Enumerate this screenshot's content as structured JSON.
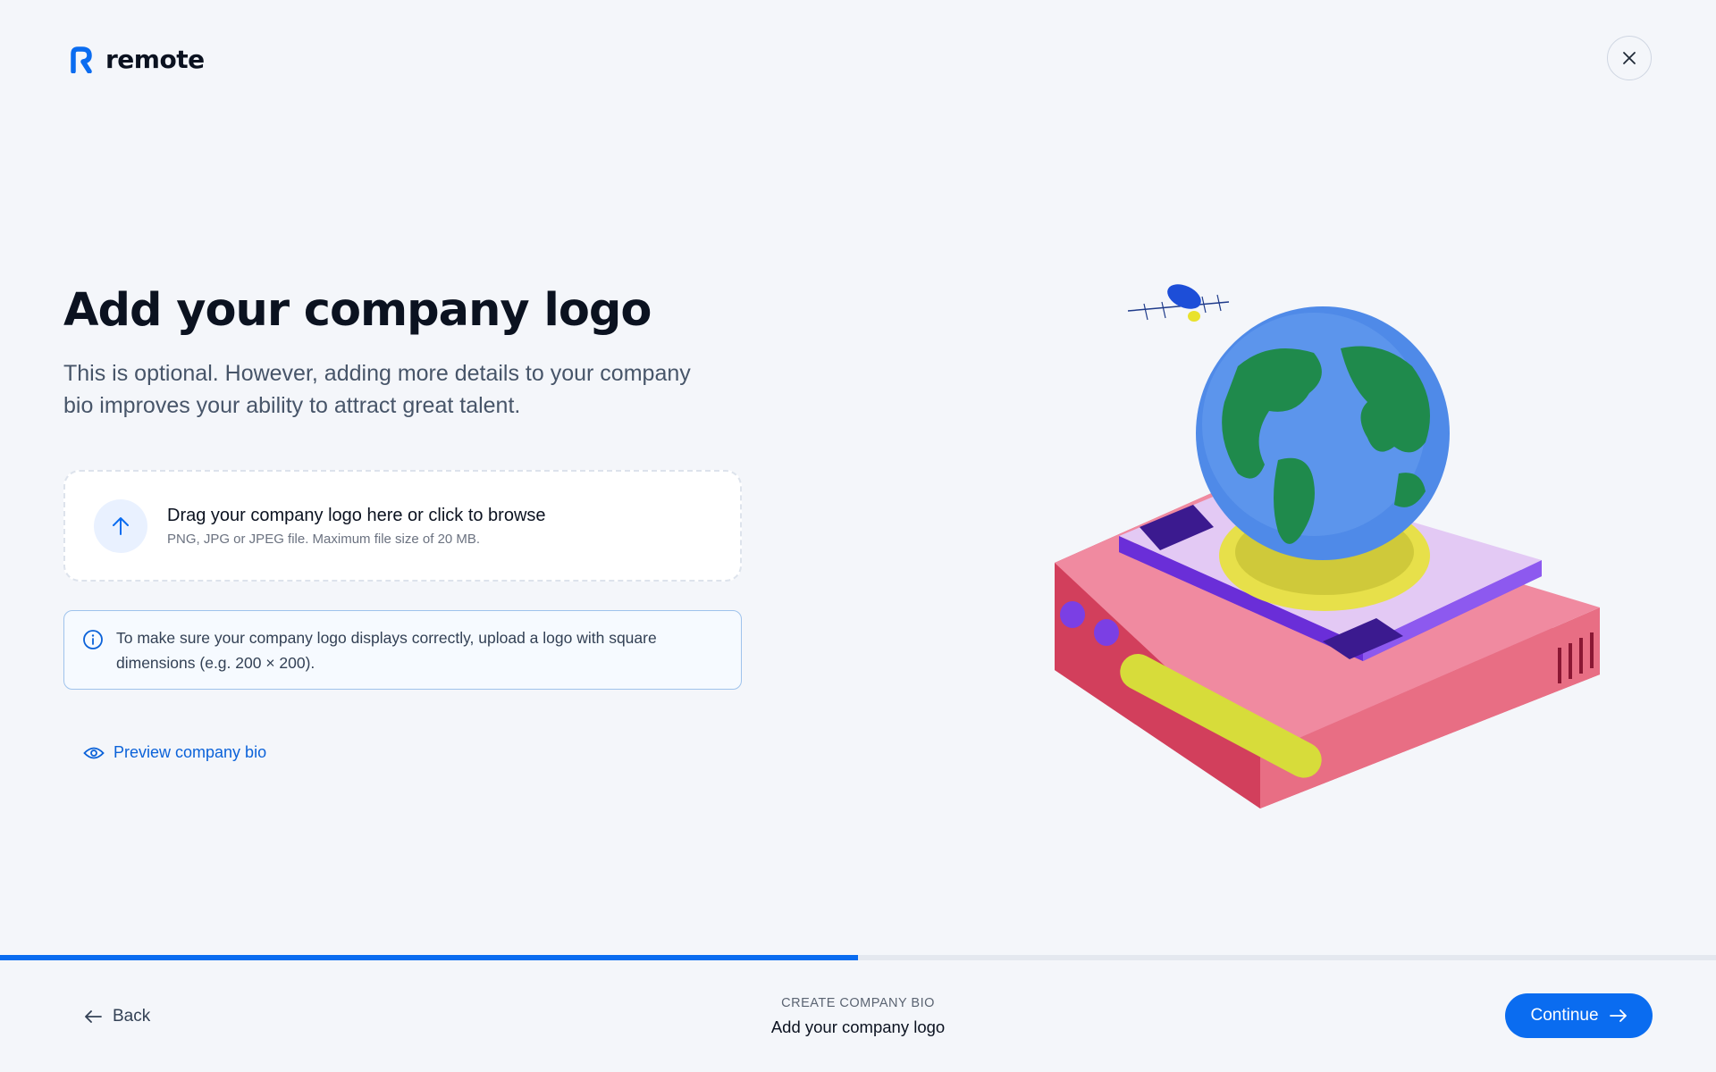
{
  "brand": {
    "name": "remote",
    "color": "#0a6cf0",
    "icon": "remote-logo-icon"
  },
  "header": {
    "close_icon": "close-icon"
  },
  "main": {
    "title": "Add your company logo",
    "subtitle": "This is optional. However, adding more details to your company bio improves your ability to attract great talent.",
    "dropzone": {
      "title": "Drag your company logo here or click to browse",
      "hint": "PNG, JPG or JPEG file. Maximum file size of 20 MB.",
      "icon": "upload-arrow-icon"
    },
    "notice": {
      "text": "To make sure your company logo displays correctly, upload a logo with square dimensions (e.g. 200 × 200).",
      "icon": "info-icon",
      "border_color": "#9fc3ec"
    },
    "preview_link": {
      "label": "Preview company bio",
      "icon": "eye-icon"
    }
  },
  "progress": {
    "fraction": 0.5,
    "fill_color": "#0a6cf0",
    "track_color": "#e4e8ef"
  },
  "footer": {
    "back_label": "Back",
    "step_eyebrow": "CREATE COMPANY BIO",
    "step_title": "Add your company logo",
    "continue_label": "Continue"
  }
}
